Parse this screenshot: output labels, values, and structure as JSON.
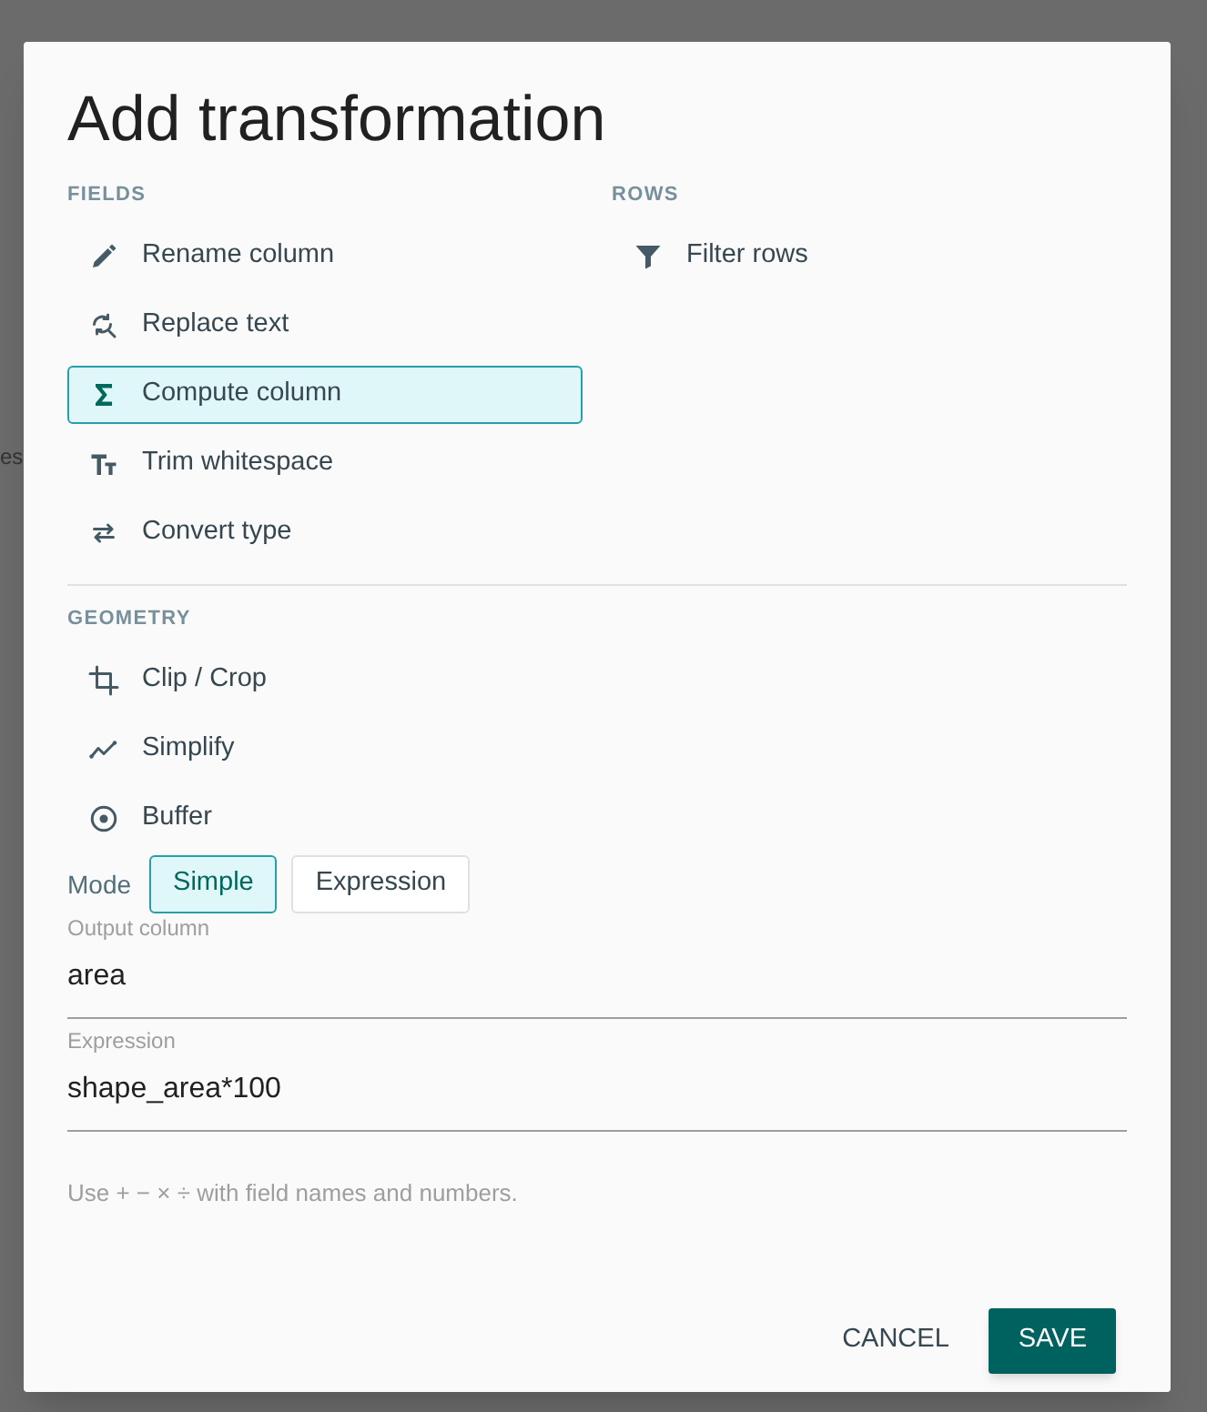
{
  "backdrop": {
    "text_fragment": "es"
  },
  "dialog": {
    "title": "Add transformation"
  },
  "sections": [
    {
      "heading": "FIELDS",
      "items": [
        {
          "label": "Rename column",
          "selected": false
        },
        {
          "label": "Replace text",
          "selected": false
        },
        {
          "label": "Compute column",
          "selected": true
        },
        {
          "label": "Trim whitespace",
          "selected": false
        },
        {
          "label": "Convert type",
          "selected": false
        }
      ]
    },
    {
      "heading": "ROWS",
      "items": [
        {
          "label": "Filter rows",
          "selected": false
        }
      ]
    },
    {
      "heading": "GEOMETRY",
      "items": [
        {
          "label": "Clip / Crop",
          "selected": false
        },
        {
          "label": "Simplify",
          "selected": false
        },
        {
          "label": "Buffer",
          "selected": false
        }
      ]
    }
  ],
  "mode": {
    "label": "Mode",
    "options": [
      {
        "label": "Simple",
        "selected": true
      },
      {
        "label": "Expression",
        "selected": false
      }
    ]
  },
  "fields": [
    {
      "label": "Output column",
      "value": "area"
    },
    {
      "label": "Expression",
      "value": "shape_area*100"
    }
  ],
  "hint": "Use + − × ÷ with field names and numbers.",
  "buttons": [
    {
      "label": "CANCEL",
      "kind": "text"
    },
    {
      "label": "SAVE",
      "kind": "primary"
    }
  ]
}
